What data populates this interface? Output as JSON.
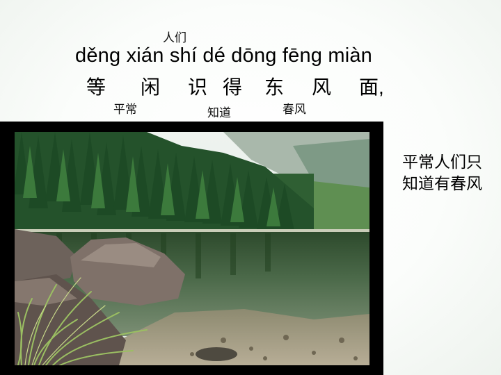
{
  "annotations": {
    "renmen": "人们",
    "pingchang": "平常",
    "zhidao": "知道",
    "chunfeng": "春风"
  },
  "pinyin_line": "děng xián shí dé dōng fēng miàn",
  "hanzi_line": [
    "等",
    "闲",
    "识",
    "得",
    "东",
    "风",
    "面,"
  ],
  "side_text": "平常人们只知道有春风",
  "colors": {
    "frame": "#000000",
    "sky": "#e9efe9",
    "forest": "#2f6b3a",
    "water": "#3f5a3a"
  }
}
